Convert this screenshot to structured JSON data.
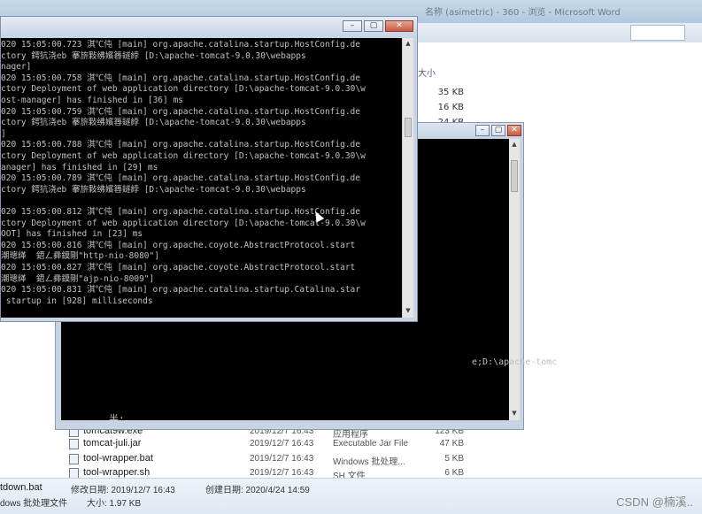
{
  "explorer": {
    "title": "名称 (asimetric) - 360 - 浏览 - Microsoft Word",
    "column_size_header": "大小",
    "sizes_top": [
      "35 KB",
      "16 KB",
      "24 KB"
    ],
    "files": [
      {
        "name": "tomcat9w.exe",
        "date": "2019/12/7 16:43",
        "type": "应用程序",
        "size": "123 KB"
      },
      {
        "name": "tomcat-juli.jar",
        "date": "2019/12/7 16:43",
        "type": "Executable Jar File",
        "size": "47 KB"
      },
      {
        "name": "tool-wrapper.bat",
        "date": "2019/12/7 16:43",
        "type": "Windows 批处理...",
        "size": "5 KB"
      },
      {
        "name": "tool-wrapper.sh",
        "date": "2019/12/7 16:43",
        "type": "SH 文件",
        "size": "6 KB"
      }
    ],
    "status": {
      "filename": "tdown.bat",
      "modified_label": "修改日期: 2019/12/7 16:43",
      "created_label": "创建日期: 2020/4/24 14:59",
      "type_label": "dows 批处理文件",
      "size_label": "大小: 1.97 KB"
    },
    "watermark": "CSDN @楠溪.."
  },
  "console_back": {
    "path_text": "e;D:\\apache-tomc",
    "prompt_text": "半:"
  },
  "console_main": {
    "lines": [
      "020 15:05:00.723 淇℃伅 [main] org.apache.catalina.startup.HostConfig.de",
      "ctory 鍔犺浇eb 搴旂敤绋嬪簭鐩綍 [D:\\apache-tomcat-9.0.30\\webapps",
      "nager]",
      "020 15:05:00.758 淇℃伅 [main] org.apache.catalina.startup.HostConfig.de",
      "ctory Deployment of web application directory [D:\\apache-tomcat-9.0.30\\w",
      "ost-manager] has finished in [36] ms",
      "020 15:05:00.759 淇℃伅 [main] org.apache.catalina.startup.HostConfig.de",
      "ctory 鍔犺浇eb 搴旂敤绋嬪簭鐩綍 [D:\\apache-tomcat-9.0.30\\webapps",
      "]",
      "020 15:05:00.788 淇℃伅 [main] org.apache.catalina.startup.HostConfig.de",
      "ctory Deployment of web application directory [D:\\apache-tomcat-9.0.30\\w",
      "anager] has finished in [29] ms",
      "020 15:05:00.789 淇℃伅 [main] org.apache.catalina.startup.HostConfig.de",
      "ctory 鍔犺浇eb 搴旂敤绋嬪簭鐩綍 [D:\\apache-tomcat-9.0.30\\webapps",
      "",
      "020 15:05:00.812 淇℃伅 [main] org.apache.catalina.startup.HostConfig.de",
      "ctory Deployment of web application directory [D:\\apache-tomcat-9.0.30\\w",
      "OOT] has finished in [23] ms",
      "020 15:05:00.816 淇℃伅 [main] org.apache.coyote.AbstractProtocol.start",
      "潮璁缂  鍣ㄥ彞鏌剛\"http-nio-8080\"]",
      "020 15:05:00.827 淇℃伅 [main] org.apache.coyote.AbstractProtocol.start",
      "潮璁缂  鍣ㄥ彞鏌剛\"ajp-nio-8009\"]",
      "020 15:05:00.831 淇℃伅 [main] org.apache.catalina.startup.Catalina.star",
      " startup in [928] milliseconds"
    ]
  }
}
